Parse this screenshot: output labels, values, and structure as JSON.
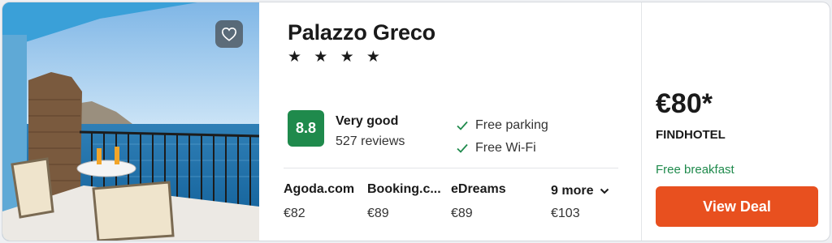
{
  "hotel": {
    "name": "Palazzo Greco",
    "stars_text": "★ ★ ★ ★",
    "star_count": 4
  },
  "rating": {
    "score": "8.8",
    "label": "Very good",
    "reviews": "527 reviews",
    "color": "#1f8a4c"
  },
  "amenities": [
    "Free parking",
    "Free Wi-Fi"
  ],
  "providers": [
    {
      "name": "Agoda.com",
      "price": "€82"
    },
    {
      "name": "Booking.c...",
      "price": "€89"
    },
    {
      "name": "eDreams",
      "price": "€89"
    }
  ],
  "more": {
    "label": "9 more",
    "price": "€103"
  },
  "deal": {
    "price": "€80*",
    "seller": "FINDHOTEL",
    "perk": "Free breakfast",
    "button_label": "View Deal",
    "button_color": "#e8501f"
  },
  "icons": {
    "favorite": "heart-icon",
    "amenity": "check-icon",
    "more": "chevron-down-icon"
  }
}
